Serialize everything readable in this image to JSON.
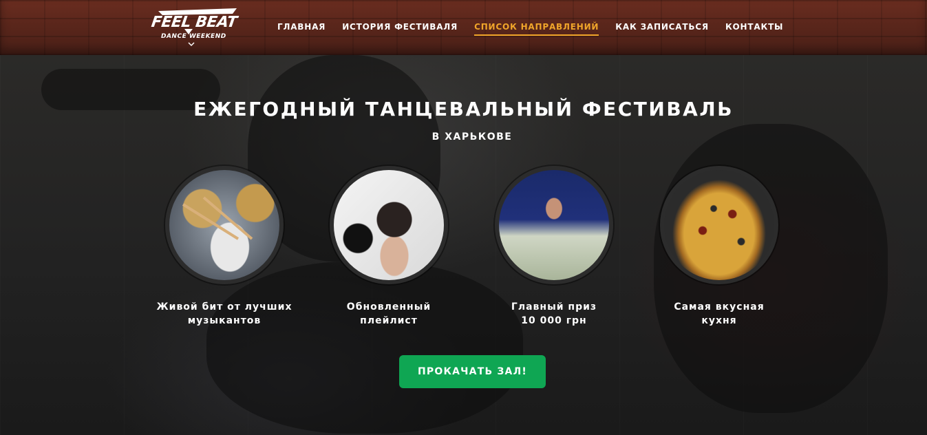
{
  "logo": {
    "main_text": "FEEL BEAT",
    "sub_text": "DANCE WEEKEND"
  },
  "nav": {
    "items": [
      {
        "label": "ГЛАВНАЯ",
        "active": false
      },
      {
        "label": "ИСТОРИЯ ФЕСТИВАЛЯ",
        "active": false
      },
      {
        "label": "СПИСОК НАПРАВЛЕНИЙ",
        "active": true
      },
      {
        "label": "КАК ЗАПИСАТЬСЯ",
        "active": false
      },
      {
        "label": "КОНТАКТЫ",
        "active": false
      }
    ]
  },
  "hero": {
    "title": "ЕЖЕГОДНЫЙ ТАНЦЕВАЛЬНЫЙ ФЕСТИВАЛЬ",
    "subtitle": "В ХАРЬКОВЕ"
  },
  "features": [
    {
      "line1": "Живой бит от лучших",
      "line2": "музыкантов",
      "image": "drummer-photo"
    },
    {
      "line1": "Обновленный",
      "line2": "плейлист",
      "image": "dj-girl-photo"
    },
    {
      "line1": "Главный приз",
      "line2": "10 000 грн",
      "image": "money-prize-photo"
    },
    {
      "line1": "Самая вкусная",
      "line2": "кухня",
      "image": "pizza-photo"
    }
  ],
  "cta": {
    "label": "ПРОКАЧАТЬ ЗАЛ!"
  },
  "colors": {
    "accent": "#f0a52a",
    "cta": "#0fa653",
    "header_brick": "#5a261b"
  }
}
